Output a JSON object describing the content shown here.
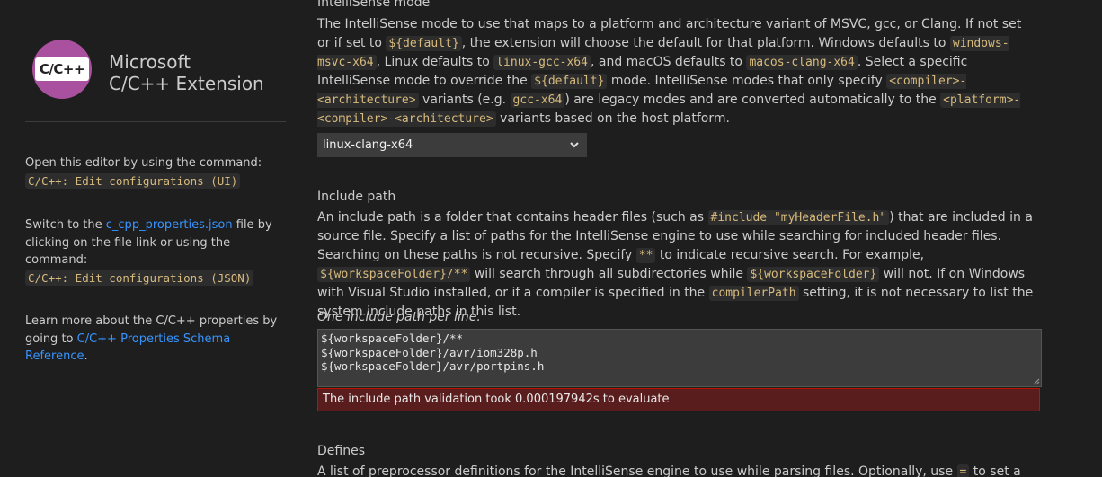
{
  "sidebar": {
    "logo_text": "C/C++",
    "brand_line1": "Microsoft",
    "brand_line2": "C/C++ Extension",
    "open_text": "Open this editor by using the command:",
    "open_command": "C/C++: Edit configurations (UI)",
    "switch_prefix": "Switch to the ",
    "switch_link": "c_cpp_properties.json",
    "switch_suffix": " file by clicking on the file link or using the command:",
    "switch_command": "C/C++: Edit configurations (JSON)",
    "learn_prefix": "Learn more about the C/C++ properties by going to ",
    "learn_link": "C/C++ Properties Schema Reference",
    "learn_suffix": "."
  },
  "intellisense": {
    "title": "IntelliSense mode",
    "t1": "The IntelliSense mode to use that maps to a platform and architecture variant of MSVC, gcc, or Clang. If not set or if set to ",
    "c1": "${default}",
    "t2": ", the extension will choose the default for that platform. Windows defaults to ",
    "c2": "windows-msvc-x64",
    "t3": ", Linux defaults to ",
    "c3": "linux-gcc-x64",
    "t4": ", and macOS defaults to ",
    "c4": "macos-clang-x64",
    "t5": ". Select a specific IntelliSense mode to override the ",
    "c5": "${default}",
    "t6": " mode. IntelliSense modes that only specify ",
    "c6": "<compiler>-<architecture>",
    "t7": " variants (e.g. ",
    "c7": "gcc-x64",
    "t8": ") are legacy modes and are converted automatically to the ",
    "c8": "<platform>-<compiler>-<architecture>",
    "t9": " variants based on the host platform.",
    "selected": "linux-clang-x64"
  },
  "include_path": {
    "title": "Include path",
    "t1": "An include path is a folder that contains header files (such as ",
    "c1": "#include \"myHeaderFile.h\"",
    "t2": ") that are included in a source file. Specify a list of paths for the IntelliSense engine to use while searching for included header files. Searching on these paths is not recursive. Specify ",
    "c2": "**",
    "t3": " to indicate recursive search. For example, ",
    "c3": "${workspaceFolder}/**",
    "t4": " will search through all subdirectories while ",
    "c4": "${workspaceFolder}",
    "t5": " will not. If on Windows with Visual Studio installed, or if a compiler is specified in the ",
    "c5": "compilerPath",
    "t6": " setting, it is not necessary to list the system include paths in this list.",
    "hint": "One include path per line.",
    "lines": [
      "${workspaceFolder}/**",
      "${workspaceFolder}/avr/iom328p.h",
      "${workspaceFolder}/avr/portpins.h"
    ],
    "validation": "The include path validation took 0.000197942s to evaluate"
  },
  "defines": {
    "title": "Defines",
    "t1": "A list of preprocessor definitions for the IntelliSense engine to use while parsing files. Optionally, use ",
    "c1": "=",
    "t2": " to set a value."
  }
}
